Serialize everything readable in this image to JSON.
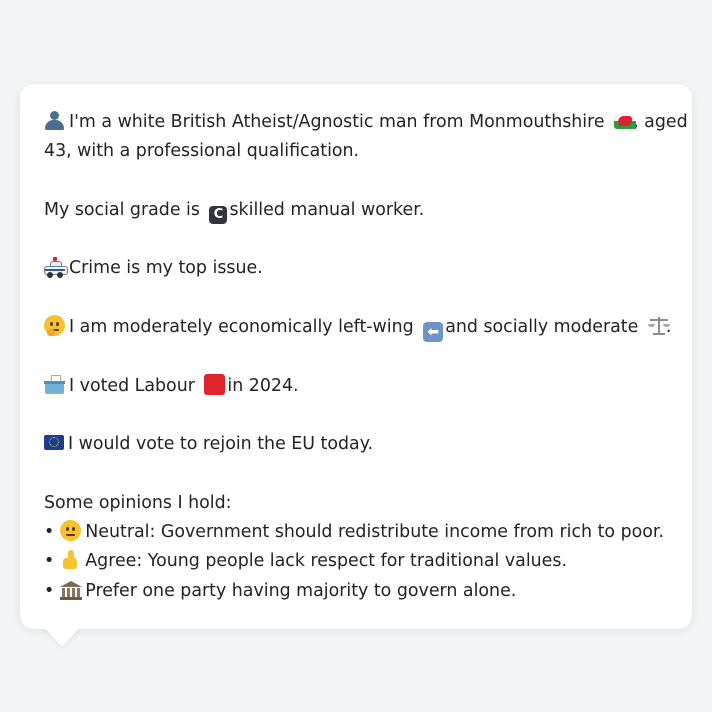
{
  "profile": {
    "intro_text": "I'm a white British Atheist/Agnostic man from Monmouthshire",
    "intro_text_after_flag": ", aged",
    "intro_line2": "43, with a professional qualification.",
    "social_grade_prefix": "My social grade is",
    "social_grade_badge": "C",
    "social_grade_suffix": "skilled manual worker.",
    "top_issue": "Crime is my top issue.",
    "ideology_part1": "I am moderately economically left-wing",
    "ideology_part2": "and socially moderate",
    "ideology_end": ".",
    "vote_part1": "I voted Labour",
    "vote_part2": "in 2024.",
    "eu_stance": "I would vote to rejoin the EU today.",
    "opinions_heading": "Some opinions I hold:",
    "opinions": [
      {
        "bullet": "•",
        "icon": "neutral-face-icon",
        "text": "Neutral: Government should redistribute income from rich to poor."
      },
      {
        "bullet": "•",
        "icon": "thumbs-up-icon",
        "text": "Agree: Young people lack respect for traditional values."
      },
      {
        "bullet": "•",
        "icon": "classical-building-icon",
        "text": "Prefer one party having majority to govern alone."
      }
    ]
  },
  "icons": {
    "person": "person-silhouette-icon",
    "wales": "wales-flag-icon",
    "grade": "c-badge-icon",
    "crime": "police-car-icon",
    "thinking": "thinking-face-icon",
    "left": "left-arrow-icon",
    "scales": "balance-scale-icon",
    "ballot": "ballot-box-icon",
    "labour": "red-square-icon",
    "eu": "eu-flag-icon"
  },
  "colors": {
    "background": "#f3f4f6",
    "card": "#ffffff",
    "text": "#232323",
    "labour_red": "#e0242b",
    "eu_blue": "#1f3d8f"
  }
}
